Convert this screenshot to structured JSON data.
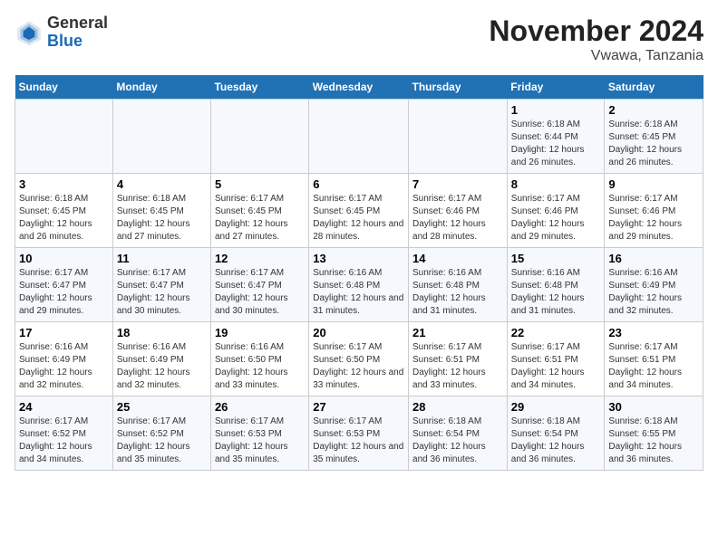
{
  "header": {
    "logo_general": "General",
    "logo_blue": "Blue",
    "title": "November 2024",
    "subtitle": "Vwawa, Tanzania"
  },
  "days_of_week": [
    "Sunday",
    "Monday",
    "Tuesday",
    "Wednesday",
    "Thursday",
    "Friday",
    "Saturday"
  ],
  "weeks": [
    [
      {
        "day": "",
        "info": ""
      },
      {
        "day": "",
        "info": ""
      },
      {
        "day": "",
        "info": ""
      },
      {
        "day": "",
        "info": ""
      },
      {
        "day": "",
        "info": ""
      },
      {
        "day": "1",
        "info": "Sunrise: 6:18 AM\nSunset: 6:44 PM\nDaylight: 12 hours and 26 minutes."
      },
      {
        "day": "2",
        "info": "Sunrise: 6:18 AM\nSunset: 6:45 PM\nDaylight: 12 hours and 26 minutes."
      }
    ],
    [
      {
        "day": "3",
        "info": "Sunrise: 6:18 AM\nSunset: 6:45 PM\nDaylight: 12 hours and 26 minutes."
      },
      {
        "day": "4",
        "info": "Sunrise: 6:18 AM\nSunset: 6:45 PM\nDaylight: 12 hours and 27 minutes."
      },
      {
        "day": "5",
        "info": "Sunrise: 6:17 AM\nSunset: 6:45 PM\nDaylight: 12 hours and 27 minutes."
      },
      {
        "day": "6",
        "info": "Sunrise: 6:17 AM\nSunset: 6:45 PM\nDaylight: 12 hours and 28 minutes."
      },
      {
        "day": "7",
        "info": "Sunrise: 6:17 AM\nSunset: 6:46 PM\nDaylight: 12 hours and 28 minutes."
      },
      {
        "day": "8",
        "info": "Sunrise: 6:17 AM\nSunset: 6:46 PM\nDaylight: 12 hours and 29 minutes."
      },
      {
        "day": "9",
        "info": "Sunrise: 6:17 AM\nSunset: 6:46 PM\nDaylight: 12 hours and 29 minutes."
      }
    ],
    [
      {
        "day": "10",
        "info": "Sunrise: 6:17 AM\nSunset: 6:47 PM\nDaylight: 12 hours and 29 minutes."
      },
      {
        "day": "11",
        "info": "Sunrise: 6:17 AM\nSunset: 6:47 PM\nDaylight: 12 hours and 30 minutes."
      },
      {
        "day": "12",
        "info": "Sunrise: 6:17 AM\nSunset: 6:47 PM\nDaylight: 12 hours and 30 minutes."
      },
      {
        "day": "13",
        "info": "Sunrise: 6:16 AM\nSunset: 6:48 PM\nDaylight: 12 hours and 31 minutes."
      },
      {
        "day": "14",
        "info": "Sunrise: 6:16 AM\nSunset: 6:48 PM\nDaylight: 12 hours and 31 minutes."
      },
      {
        "day": "15",
        "info": "Sunrise: 6:16 AM\nSunset: 6:48 PM\nDaylight: 12 hours and 31 minutes."
      },
      {
        "day": "16",
        "info": "Sunrise: 6:16 AM\nSunset: 6:49 PM\nDaylight: 12 hours and 32 minutes."
      }
    ],
    [
      {
        "day": "17",
        "info": "Sunrise: 6:16 AM\nSunset: 6:49 PM\nDaylight: 12 hours and 32 minutes."
      },
      {
        "day": "18",
        "info": "Sunrise: 6:16 AM\nSunset: 6:49 PM\nDaylight: 12 hours and 32 minutes."
      },
      {
        "day": "19",
        "info": "Sunrise: 6:16 AM\nSunset: 6:50 PM\nDaylight: 12 hours and 33 minutes."
      },
      {
        "day": "20",
        "info": "Sunrise: 6:17 AM\nSunset: 6:50 PM\nDaylight: 12 hours and 33 minutes."
      },
      {
        "day": "21",
        "info": "Sunrise: 6:17 AM\nSunset: 6:51 PM\nDaylight: 12 hours and 33 minutes."
      },
      {
        "day": "22",
        "info": "Sunrise: 6:17 AM\nSunset: 6:51 PM\nDaylight: 12 hours and 34 minutes."
      },
      {
        "day": "23",
        "info": "Sunrise: 6:17 AM\nSunset: 6:51 PM\nDaylight: 12 hours and 34 minutes."
      }
    ],
    [
      {
        "day": "24",
        "info": "Sunrise: 6:17 AM\nSunset: 6:52 PM\nDaylight: 12 hours and 34 minutes."
      },
      {
        "day": "25",
        "info": "Sunrise: 6:17 AM\nSunset: 6:52 PM\nDaylight: 12 hours and 35 minutes."
      },
      {
        "day": "26",
        "info": "Sunrise: 6:17 AM\nSunset: 6:53 PM\nDaylight: 12 hours and 35 minutes."
      },
      {
        "day": "27",
        "info": "Sunrise: 6:17 AM\nSunset: 6:53 PM\nDaylight: 12 hours and 35 minutes."
      },
      {
        "day": "28",
        "info": "Sunrise: 6:18 AM\nSunset: 6:54 PM\nDaylight: 12 hours and 36 minutes."
      },
      {
        "day": "29",
        "info": "Sunrise: 6:18 AM\nSunset: 6:54 PM\nDaylight: 12 hours and 36 minutes."
      },
      {
        "day": "30",
        "info": "Sunrise: 6:18 AM\nSunset: 6:55 PM\nDaylight: 12 hours and 36 minutes."
      }
    ]
  ]
}
